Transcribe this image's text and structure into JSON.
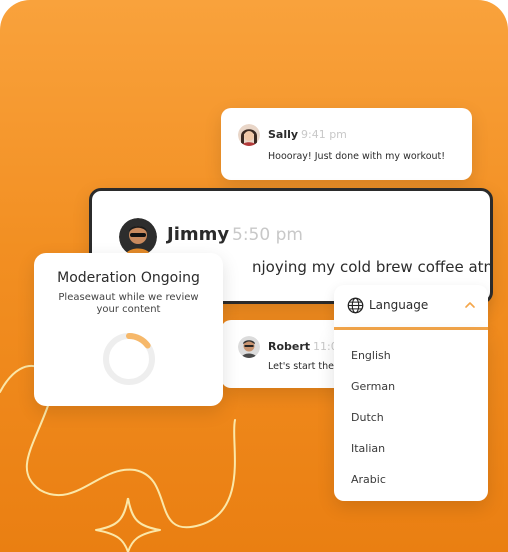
{
  "sally": {
    "name": "Sally",
    "time": "9:41 pm",
    "message": "Hoooray! Just done with my workout!"
  },
  "jimmy": {
    "name": "Jimmy",
    "time": "5:50 pm",
    "message": "njoying my cold brew coffee atm."
  },
  "robert": {
    "name": "Robert",
    "time": "11:0",
    "message": "Let's start the"
  },
  "moderation": {
    "title": "Moderation Ongoing",
    "subtitle": "Pleasewaut  while we review your content",
    "progress": 0.15
  },
  "language": {
    "label": "Language",
    "options": [
      "English",
      "German",
      "Dutch",
      "Italian",
      "Arabic"
    ]
  },
  "colors": {
    "accent": "#f4a64a",
    "background_top": "#f9a23c",
    "background_bottom": "#ea7f12"
  },
  "icons": {
    "dropdown_leading": "globe-icon",
    "dropdown_trailing": "chevron-up-icon"
  }
}
